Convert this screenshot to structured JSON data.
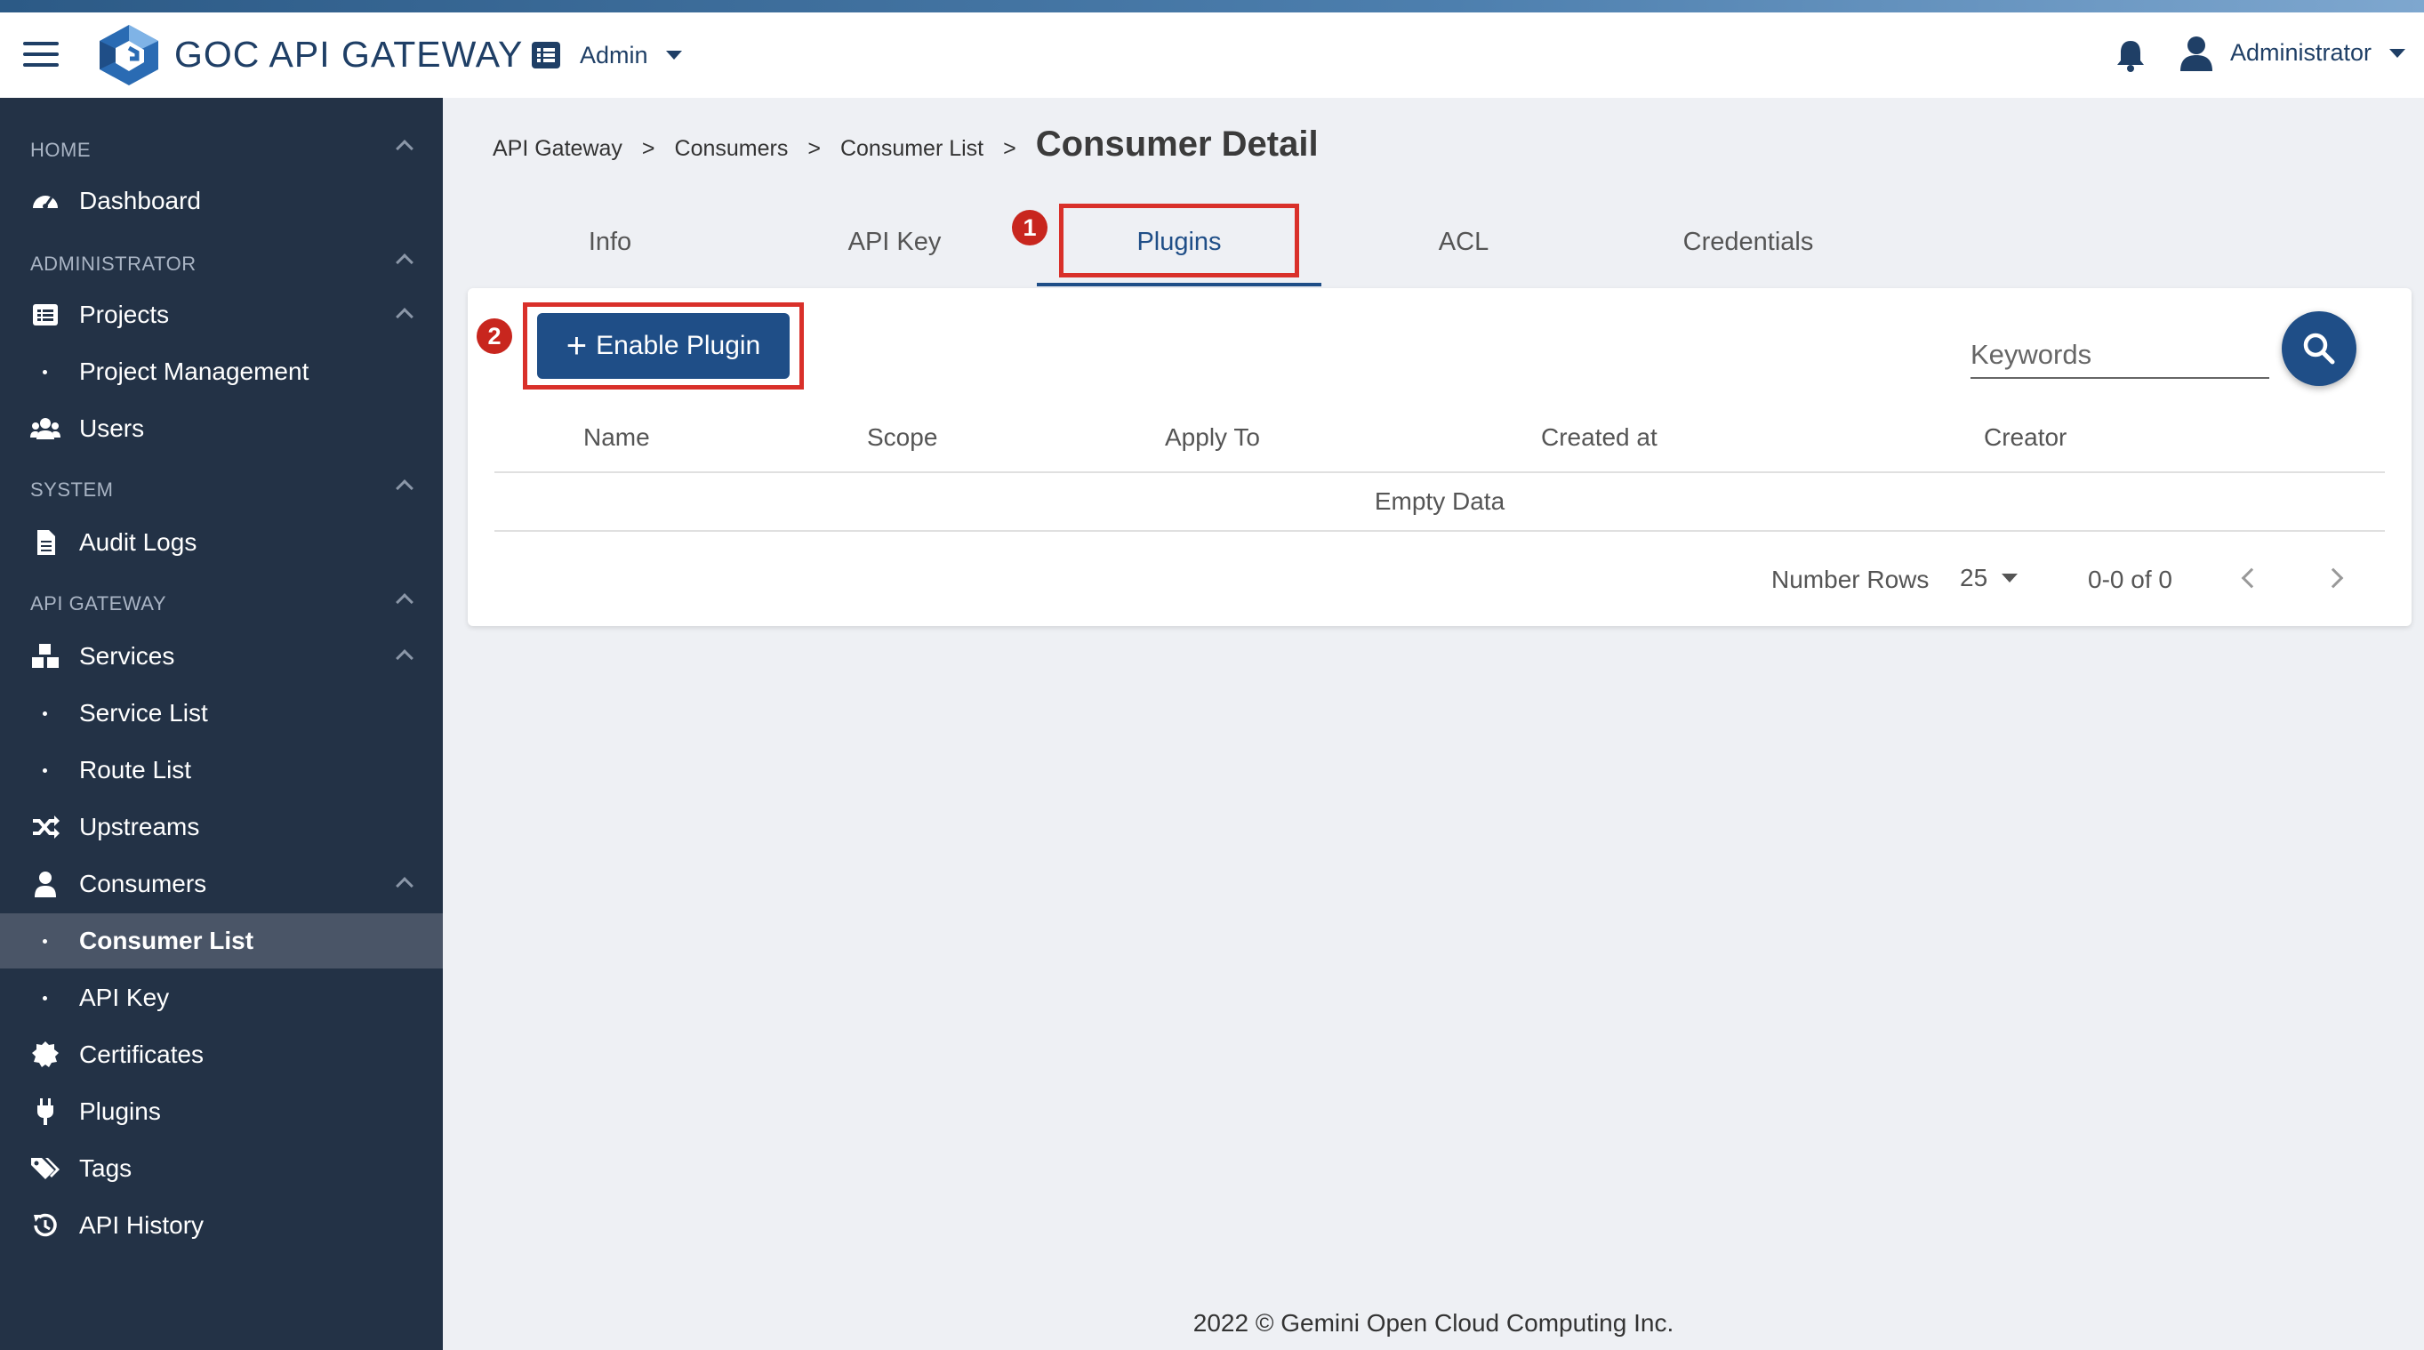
{
  "header": {
    "brand": "GOC API GATEWAY",
    "project_selector": "Admin",
    "user_name": "Administrator"
  },
  "sidebar": {
    "sections": {
      "home": "HOME",
      "administrator": "ADMINISTRATOR",
      "system": "SYSTEM",
      "api_gateway": "API GATEWAY"
    },
    "items": {
      "dashboard": "Dashboard",
      "projects": "Projects",
      "project_management": "Project Management",
      "users": "Users",
      "audit_logs": "Audit Logs",
      "services": "Services",
      "service_list": "Service List",
      "route_list": "Route List",
      "upstreams": "Upstreams",
      "consumers": "Consumers",
      "consumer_list": "Consumer List",
      "api_key": "API Key",
      "certificates": "Certificates",
      "plugins": "Plugins",
      "tags": "Tags",
      "api_history": "API History"
    }
  },
  "breadcrumb": {
    "items": [
      "API Gateway",
      "Consumers",
      "Consumer List"
    ],
    "separator": ">",
    "current": "Consumer Detail"
  },
  "tabs": [
    "Info",
    "API Key",
    "Plugins",
    "ACL",
    "Credentials"
  ],
  "active_tab": "Plugins",
  "annotations": [
    "1",
    "2"
  ],
  "toolbar": {
    "enable_plugin_label": "Enable Plugin",
    "keywords_placeholder": "Keywords"
  },
  "table": {
    "columns": [
      "Name",
      "Scope",
      "Apply To",
      "Created at",
      "Creator"
    ],
    "empty_text": "Empty Data"
  },
  "pagination": {
    "rows_label": "Number Rows",
    "rows_per_page": "25",
    "range": "0-0 of 0"
  },
  "footer": "2022 © Gemini Open Cloud Computing Inc.",
  "colors": {
    "primary": "#1f4e87",
    "sidebar_bg": "#233246",
    "highlight": "#d9302a"
  }
}
